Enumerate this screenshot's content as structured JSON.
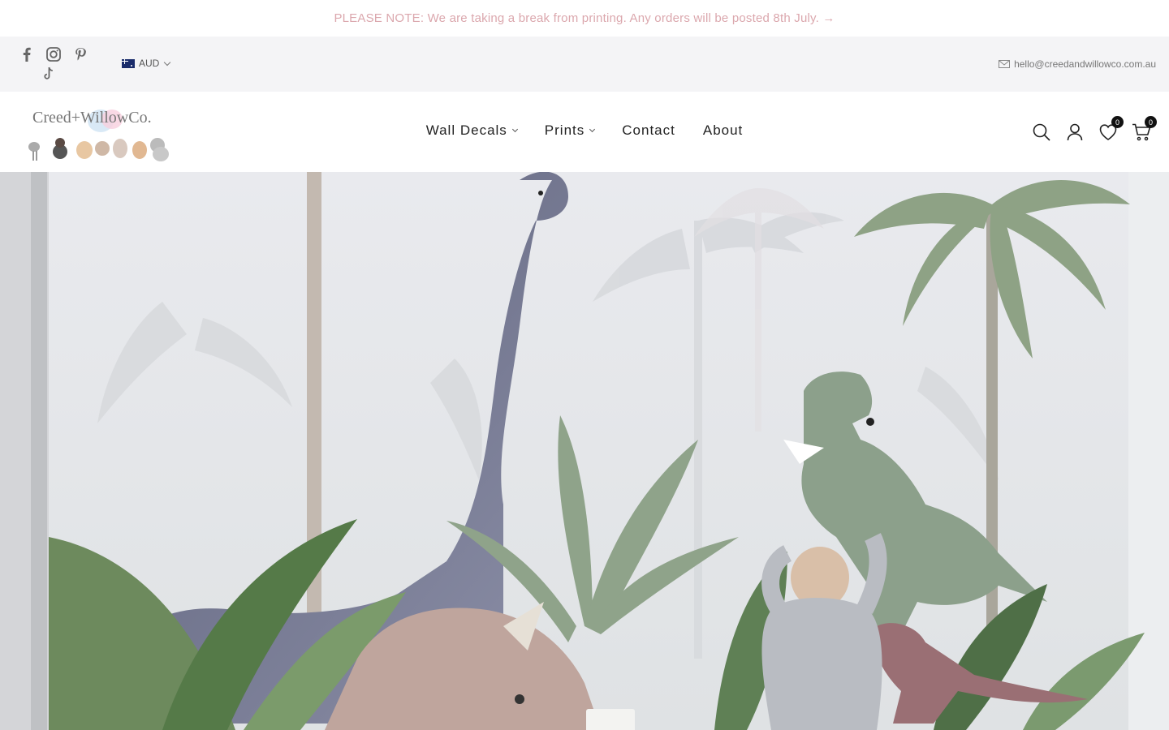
{
  "announcement": {
    "text": "PLEASE NOTE: We are taking a break from printing. Any orders will be posted 8th July. →"
  },
  "topbar": {
    "socials": [
      "facebook-icon",
      "instagram-icon",
      "pinterest-icon",
      "tiktok-icon"
    ],
    "currency": "AUD",
    "email": "hello@creedandwillowco.com.au"
  },
  "header": {
    "logo_text": "Creed+WillowCo.",
    "nav": [
      {
        "label": "Wall Decals",
        "has_dropdown": true
      },
      {
        "label": "Prints",
        "has_dropdown": true
      },
      {
        "label": "Contact",
        "has_dropdown": false
      },
      {
        "label": "About",
        "has_dropdown": false
      }
    ],
    "icons": [
      "search-icon",
      "account-icon",
      "wishlist-icon",
      "cart-icon"
    ],
    "wishlist_count": "0",
    "cart_count": "0"
  },
  "colors": {
    "announcement_text": "#dba7ad",
    "topbar_bg": "#f4f4f6",
    "badge_bg": "#111111"
  }
}
